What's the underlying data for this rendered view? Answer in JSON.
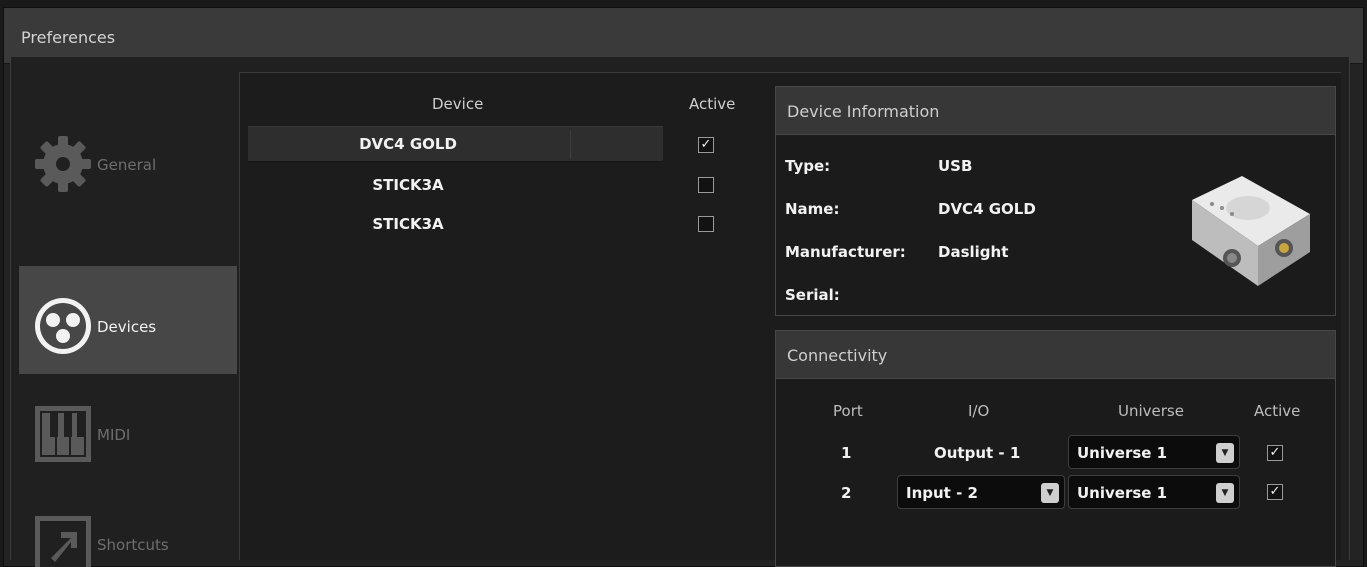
{
  "window": {
    "title": "Preferences"
  },
  "sidebar": {
    "items": [
      {
        "label": "General",
        "icon": "gear-icon"
      },
      {
        "label": "Devices",
        "icon": "devices-icon"
      },
      {
        "label": "MIDI",
        "icon": "piano-keys-icon"
      },
      {
        "label": "Shortcuts",
        "icon": "shortcut-arrow-icon"
      }
    ],
    "active": "Devices"
  },
  "devices": {
    "col_device": "Device",
    "col_active": "Active",
    "rows": [
      {
        "name": "DVC4 GOLD",
        "active": true,
        "selected": true
      },
      {
        "name": "STICK3A",
        "active": false,
        "selected": false
      },
      {
        "name": "STICK3A",
        "active": false,
        "selected": false
      }
    ]
  },
  "device_info": {
    "header": "Device Information",
    "type_label": "Type:",
    "type_value": "USB",
    "name_label": "Name:",
    "name_value": "DVC4 GOLD",
    "manufacturer_label": "Manufacturer:",
    "manufacturer_value": "Daslight",
    "serial_label": "Serial:",
    "serial_value": ""
  },
  "connectivity": {
    "header": "Connectivity",
    "col_port": "Port",
    "col_io": "I/O",
    "col_universe": "Universe",
    "col_active": "Active",
    "rows": [
      {
        "port": "1",
        "io": "Output - 1",
        "io_dropdown": false,
        "universe": "Universe 1",
        "active": true
      },
      {
        "port": "2",
        "io": "Input - 2",
        "io_dropdown": true,
        "universe": "Universe 1",
        "active": true
      }
    ]
  },
  "colors": {
    "accent": "#474747",
    "background": "#1c1c1c",
    "text": "#f2f2f2"
  }
}
